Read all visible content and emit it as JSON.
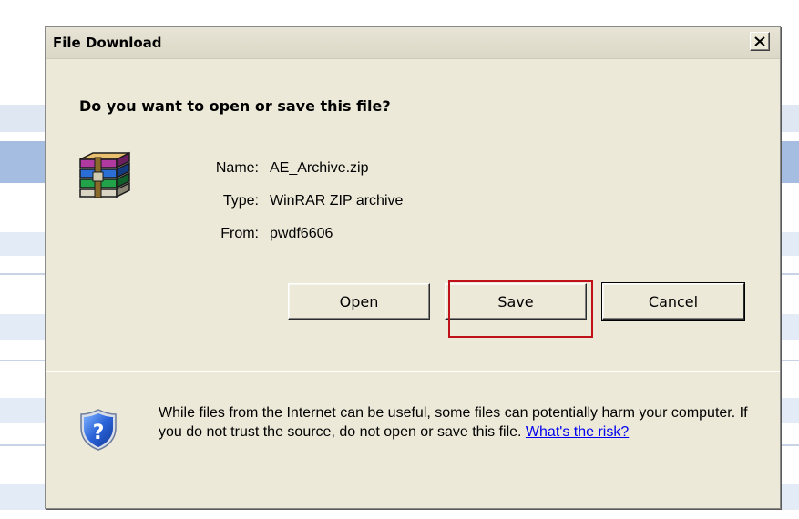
{
  "dialog": {
    "title": "File Download",
    "question": "Do you want to open or save this file?",
    "file": {
      "name_label": "Name:",
      "name_value": "AE_Archive.zip",
      "type_label": "Type:",
      "type_value": "WinRAR ZIP archive",
      "from_label": "From:",
      "from_value": "pwdf6606"
    },
    "buttons": {
      "open": "Open",
      "save": "Save",
      "cancel": "Cancel"
    },
    "warning": {
      "text": "While files from the Internet can be useful, some files can potentially harm your computer. If you do not trust the source, do not open or save this file.",
      "link": "What's the risk?"
    },
    "icons": {
      "file": "winrar-archive-icon",
      "warning": "shield-question-icon",
      "close": "close-icon"
    }
  },
  "colors": {
    "dialog_bg": "#ece9d8",
    "highlight": "#c0111b",
    "link": "#0000ee",
    "background_row_highlight": "#9fb7de",
    "background_row_light": "#e0e8f4"
  }
}
